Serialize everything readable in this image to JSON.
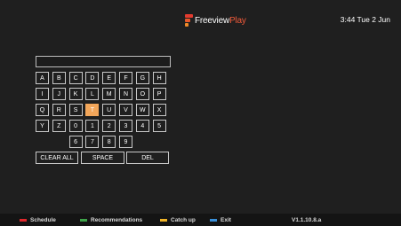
{
  "header": {
    "logo_word1": "Freeview",
    "logo_word2": "Play",
    "clock": "3:44 Tue 2 Jun"
  },
  "search": {
    "value": ""
  },
  "keyboard": {
    "rows": [
      [
        "A",
        "B",
        "C",
        "D",
        "E",
        "F",
        "G",
        "H"
      ],
      [
        "I",
        "J",
        "K",
        "L",
        "M",
        "N",
        "O",
        "P"
      ],
      [
        "Q",
        "R",
        "S",
        "T",
        "U",
        "V",
        "W",
        "X"
      ],
      [
        "Y",
        "Z",
        "0",
        "1",
        "2",
        "3",
        "4",
        "5"
      ],
      [
        "6",
        "7",
        "8",
        "9"
      ]
    ],
    "selected_key": "T",
    "clear_all_label": "CLEAR ALL",
    "space_label": "SPACE",
    "del_label": "DEL"
  },
  "footer": {
    "items": [
      {
        "label": "Schedule",
        "color": "#e0282c"
      },
      {
        "label": "Recommendations",
        "color": "#3ea34a"
      },
      {
        "label": "Catch up",
        "color": "#f0b428"
      },
      {
        "label": "Exit",
        "color": "#3a8fd8"
      }
    ],
    "version": "V1.1.10.8.a"
  }
}
